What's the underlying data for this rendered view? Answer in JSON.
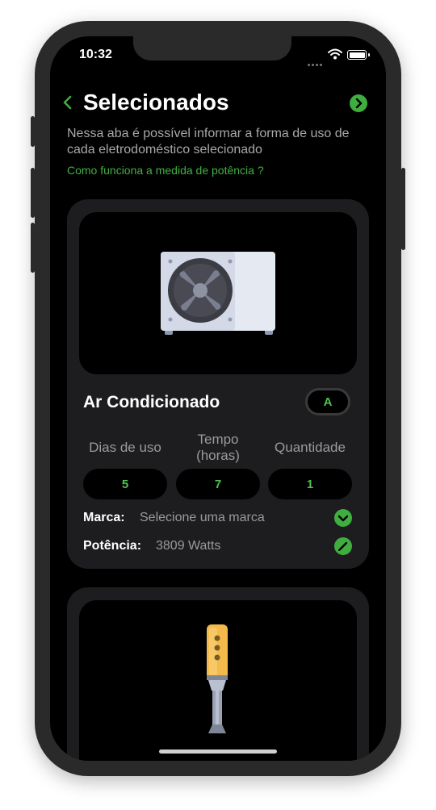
{
  "status_bar": {
    "time": "10:32"
  },
  "header": {
    "title": "Selecionados",
    "description": "Nessa aba é possível informar a forma de uso de cada eletrodoméstico selecionado",
    "help_link": "Como funciona a medida de potência ?"
  },
  "cards": [
    {
      "name": "Ar Condicionado",
      "badge": "A",
      "image_icon": "air-conditioner-icon",
      "columns": [
        {
          "label": "Dias de uso",
          "value": "5"
        },
        {
          "label": "Tempo (horas)",
          "value": "7"
        },
        {
          "label": "Quantidade",
          "value": "1"
        }
      ],
      "brand_label": "Marca:",
      "brand_value": "Selecione uma marca",
      "power_label": "Potência:",
      "power_value": "3809 Watts"
    },
    {
      "image_icon": "hand-blender-icon"
    }
  ],
  "colors": {
    "accent": "#3fae3f",
    "background": "#000000",
    "card": "#1d1d1f"
  }
}
